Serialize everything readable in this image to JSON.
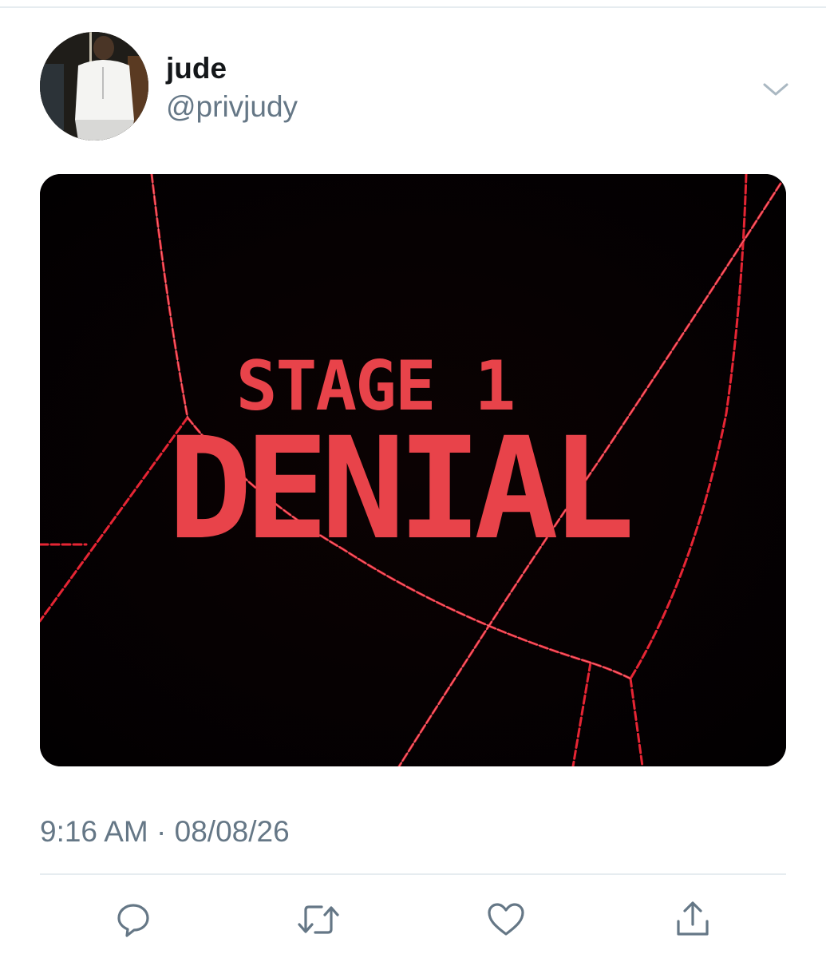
{
  "tweet": {
    "author": {
      "display_name": "jude",
      "handle": "@privjudy"
    },
    "media": {
      "title_line1": "STAGE 1",
      "title_line2": "DENIAL",
      "text_color": "#e8434a",
      "laser_color": "#ff2a3a",
      "background_color": "#040102"
    },
    "timestamp": {
      "time": "9:16 AM",
      "separator": " · ",
      "date": "08/08/26"
    },
    "actions": [
      {
        "icon": "reply-icon"
      },
      {
        "icon": "retweet-icon"
      },
      {
        "icon": "heart-icon"
      },
      {
        "icon": "share-icon"
      }
    ],
    "menu_icon": "chevron-down-icon"
  },
  "colors": {
    "text_primary": "#14171a",
    "text_secondary": "#657786",
    "divider": "#e6ecf0",
    "icon": "#657786"
  }
}
